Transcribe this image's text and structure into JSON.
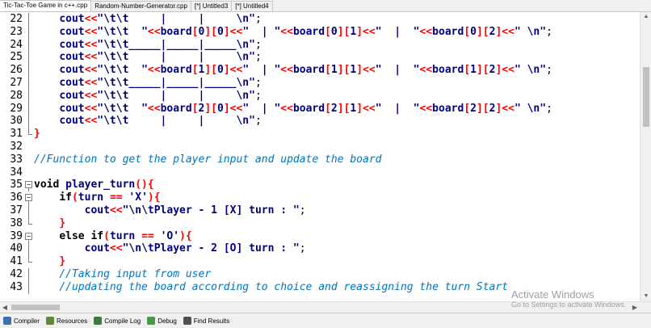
{
  "tabs": [
    "Tic-Tac-Toe Game in c++.cpp",
    "Random-Number-Generator.cpp",
    "[*] Untitled3",
    "[*] Untitled4"
  ],
  "active_tab": 0,
  "lines": [
    {
      "n": "22",
      "fold": "line",
      "tokens": [
        [
          "p",
          "    "
        ],
        [
          "s",
          "cout"
        ],
        [
          "o",
          "<<"
        ],
        [
          "s",
          "\"\\t\\t     |     |     \\n\""
        ],
        [
          "p",
          ";"
        ]
      ]
    },
    {
      "n": "23",
      "fold": "line",
      "tokens": [
        [
          "p",
          "    "
        ],
        [
          "s",
          "cout"
        ],
        [
          "o",
          "<<"
        ],
        [
          "s",
          "\"\\t\\t  \""
        ],
        [
          "o",
          "<<"
        ],
        [
          "s",
          "board"
        ],
        [
          "o",
          "["
        ],
        [
          "s",
          "0"
        ],
        [
          "o",
          "]["
        ],
        [
          "s",
          "0"
        ],
        [
          "o",
          "]<<"
        ],
        [
          "s",
          "\"  | \""
        ],
        [
          "o",
          "<<"
        ],
        [
          "s",
          "board"
        ],
        [
          "o",
          "["
        ],
        [
          "s",
          "0"
        ],
        [
          "o",
          "]["
        ],
        [
          "s",
          "1"
        ],
        [
          "o",
          "]<<"
        ],
        [
          "s",
          "\"  |  \""
        ],
        [
          "o",
          "<<"
        ],
        [
          "s",
          "board"
        ],
        [
          "o",
          "["
        ],
        [
          "s",
          "0"
        ],
        [
          "o",
          "]["
        ],
        [
          "s",
          "2"
        ],
        [
          "o",
          "]<<"
        ],
        [
          "s",
          "\" \\n\""
        ],
        [
          "p",
          ";"
        ]
      ]
    },
    {
      "n": "24",
      "fold": "line",
      "tokens": [
        [
          "p",
          "    "
        ],
        [
          "s",
          "cout"
        ],
        [
          "o",
          "<<"
        ],
        [
          "s",
          "\"\\t\\t_____|_____|_____\\n\""
        ],
        [
          "p",
          ";"
        ]
      ]
    },
    {
      "n": "25",
      "fold": "line",
      "tokens": [
        [
          "p",
          "    "
        ],
        [
          "s",
          "cout"
        ],
        [
          "o",
          "<<"
        ],
        [
          "s",
          "\"\\t\\t     |     |     \\n\""
        ],
        [
          "p",
          ";"
        ]
      ]
    },
    {
      "n": "26",
      "fold": "line",
      "tokens": [
        [
          "p",
          "    "
        ],
        [
          "s",
          "cout"
        ],
        [
          "o",
          "<<"
        ],
        [
          "s",
          "\"\\t\\t  \""
        ],
        [
          "o",
          "<<"
        ],
        [
          "s",
          "board"
        ],
        [
          "o",
          "["
        ],
        [
          "s",
          "1"
        ],
        [
          "o",
          "]["
        ],
        [
          "s",
          "0"
        ],
        [
          "o",
          "]<<"
        ],
        [
          "s",
          "\"  | \""
        ],
        [
          "o",
          "<<"
        ],
        [
          "s",
          "board"
        ],
        [
          "o",
          "["
        ],
        [
          "s",
          "1"
        ],
        [
          "o",
          "]["
        ],
        [
          "s",
          "1"
        ],
        [
          "o",
          "]<<"
        ],
        [
          "s",
          "\"  |  \""
        ],
        [
          "o",
          "<<"
        ],
        [
          "s",
          "board"
        ],
        [
          "o",
          "["
        ],
        [
          "s",
          "1"
        ],
        [
          "o",
          "]["
        ],
        [
          "s",
          "2"
        ],
        [
          "o",
          "]<<"
        ],
        [
          "s",
          "\" \\n\""
        ],
        [
          "p",
          ";"
        ]
      ]
    },
    {
      "n": "27",
      "fold": "line",
      "tokens": [
        [
          "p",
          "    "
        ],
        [
          "s",
          "cout"
        ],
        [
          "o",
          "<<"
        ],
        [
          "s",
          "\"\\t\\t_____|_____|_____\\n\""
        ],
        [
          "p",
          ";"
        ]
      ]
    },
    {
      "n": "28",
      "fold": "line",
      "tokens": [
        [
          "p",
          "    "
        ],
        [
          "s",
          "cout"
        ],
        [
          "o",
          "<<"
        ],
        [
          "s",
          "\"\\t\\t     |     |     \\n\""
        ],
        [
          "p",
          ";"
        ]
      ]
    },
    {
      "n": "29",
      "fold": "line",
      "tokens": [
        [
          "p",
          "    "
        ],
        [
          "s",
          "cout"
        ],
        [
          "o",
          "<<"
        ],
        [
          "s",
          "\"\\t\\t  \""
        ],
        [
          "o",
          "<<"
        ],
        [
          "s",
          "board"
        ],
        [
          "o",
          "["
        ],
        [
          "s",
          "2"
        ],
        [
          "o",
          "]["
        ],
        [
          "s",
          "0"
        ],
        [
          "o",
          "]<<"
        ],
        [
          "s",
          "\"  | \""
        ],
        [
          "o",
          "<<"
        ],
        [
          "s",
          "board"
        ],
        [
          "o",
          "["
        ],
        [
          "s",
          "2"
        ],
        [
          "o",
          "]["
        ],
        [
          "s",
          "1"
        ],
        [
          "o",
          "]<<"
        ],
        [
          "s",
          "\"  |  \""
        ],
        [
          "o",
          "<<"
        ],
        [
          "s",
          "board"
        ],
        [
          "o",
          "["
        ],
        [
          "s",
          "2"
        ],
        [
          "o",
          "]["
        ],
        [
          "s",
          "2"
        ],
        [
          "o",
          "]<<"
        ],
        [
          "s",
          "\" \\n\""
        ],
        [
          "p",
          ";"
        ]
      ]
    },
    {
      "n": "30",
      "fold": "line",
      "tokens": [
        [
          "p",
          "    "
        ],
        [
          "s",
          "cout"
        ],
        [
          "o",
          "<<"
        ],
        [
          "s",
          "\"\\t\\t     |     |     \\n\""
        ],
        [
          "p",
          ";"
        ]
      ]
    },
    {
      "n": "31",
      "fold": "end",
      "tokens": [
        [
          "o",
          "}"
        ]
      ]
    },
    {
      "n": "32",
      "fold": "",
      "tokens": []
    },
    {
      "n": "33",
      "fold": "",
      "tokens": [
        [
          "c",
          "//Function to get the player input and update the board"
        ]
      ]
    },
    {
      "n": "34",
      "fold": "",
      "tokens": []
    },
    {
      "n": "35",
      "fold": "open",
      "tokens": [
        [
          "k",
          "void"
        ],
        [
          "p",
          " "
        ],
        [
          "s",
          "player_turn"
        ],
        [
          "o",
          "(){"
        ]
      ]
    },
    {
      "n": "36",
      "fold": "open",
      "tokens": [
        [
          "p",
          "    "
        ],
        [
          "k",
          "if"
        ],
        [
          "o",
          "("
        ],
        [
          "s",
          "turn"
        ],
        [
          "p",
          " "
        ],
        [
          "o",
          "=="
        ],
        [
          "p",
          " "
        ],
        [
          "s",
          "'X'"
        ],
        [
          "o",
          "){"
        ]
      ]
    },
    {
      "n": "37",
      "fold": "line",
      "tokens": [
        [
          "p",
          "        "
        ],
        [
          "s",
          "cout"
        ],
        [
          "o",
          "<<"
        ],
        [
          "s",
          "\"\\n\\tPlayer - 1 [X] turn : \""
        ],
        [
          "p",
          ";"
        ]
      ]
    },
    {
      "n": "38",
      "fold": "end",
      "tokens": [
        [
          "p",
          "    "
        ],
        [
          "o",
          "}"
        ]
      ]
    },
    {
      "n": "39",
      "fold": "open",
      "tokens": [
        [
          "p",
          "    "
        ],
        [
          "k",
          "else if"
        ],
        [
          "o",
          "("
        ],
        [
          "s",
          "turn"
        ],
        [
          "p",
          " "
        ],
        [
          "o",
          "=="
        ],
        [
          "p",
          " "
        ],
        [
          "s",
          "'O'"
        ],
        [
          "o",
          "){"
        ]
      ]
    },
    {
      "n": "40",
      "fold": "line",
      "tokens": [
        [
          "p",
          "        "
        ],
        [
          "s",
          "cout"
        ],
        [
          "o",
          "<<"
        ],
        [
          "s",
          "\"\\n\\tPlayer - 2 [O] turn : \""
        ],
        [
          "p",
          ";"
        ]
      ]
    },
    {
      "n": "41",
      "fold": "end",
      "tokens": [
        [
          "p",
          "    "
        ],
        [
          "o",
          "}"
        ]
      ]
    },
    {
      "n": "42",
      "fold": "line",
      "tokens": [
        [
          "p",
          "    "
        ],
        [
          "c",
          "//Taking input from user"
        ]
      ]
    },
    {
      "n": "43",
      "fold": "line",
      "tokens": [
        [
          "p",
          "    "
        ],
        [
          "c",
          "//updating the board according to choice and reassigning the turn Start"
        ]
      ]
    }
  ],
  "watermark": {
    "title": "Activate Windows",
    "subtitle": "Go to Settings to activate Windows."
  },
  "bottom_tabs": [
    {
      "label": "Compiler",
      "icon": "compiler-icon",
      "color": "#3a6fb0"
    },
    {
      "label": "Resources",
      "icon": "resources-icon",
      "color": "#5a8a3a"
    },
    {
      "label": "Compile Log",
      "icon": "compile-log-icon",
      "color": "#3a7a3a"
    },
    {
      "label": "Debug",
      "icon": "debug-icon",
      "color": "#4a9a4a"
    },
    {
      "label": "Find Results",
      "icon": "find-results-icon",
      "color": "#505050"
    }
  ]
}
